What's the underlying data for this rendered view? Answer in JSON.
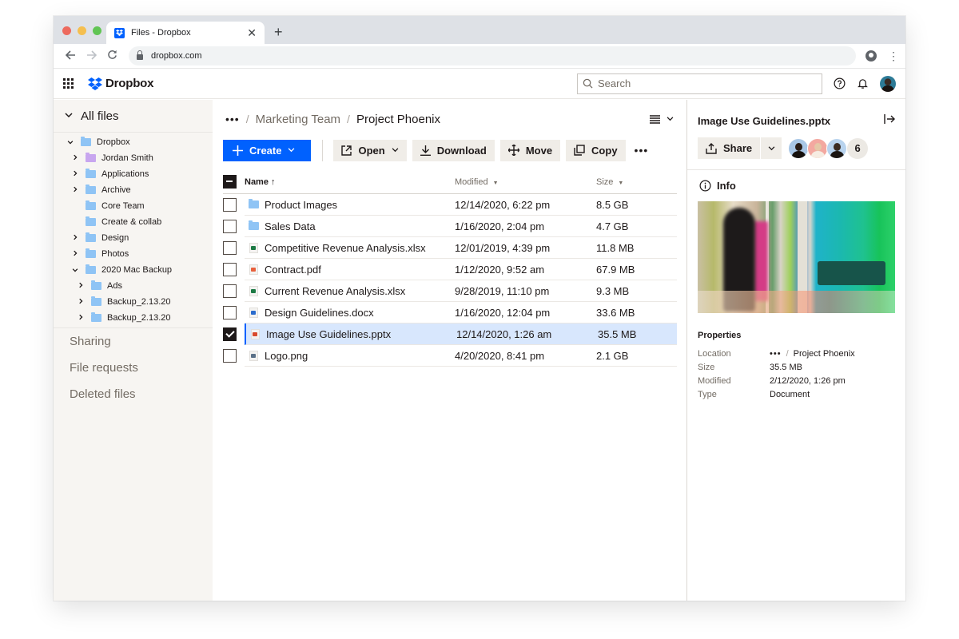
{
  "browser": {
    "tab_title": "Files - Dropbox",
    "url": "dropbox.com",
    "new_tab_label": "+"
  },
  "app": {
    "brand": "Dropbox",
    "search_placeholder": "Search",
    "accent_color": "#0061fe"
  },
  "sidebar": {
    "root_label": "All files",
    "tree": [
      {
        "label": "Dropbox",
        "level": 0,
        "expander": "expanded",
        "folder": "dropbox"
      },
      {
        "label": "Jordan Smith",
        "level": 1,
        "expander": "collapsed",
        "folder": "purple"
      },
      {
        "label": "Applications",
        "level": 1,
        "expander": "collapsed",
        "folder": "blue"
      },
      {
        "label": "Archive",
        "level": 1,
        "expander": "collapsed",
        "folder": "blue"
      },
      {
        "label": "Core Team",
        "level": 1,
        "expander": "none",
        "folder": "blue"
      },
      {
        "label": "Create & collab",
        "level": 1,
        "expander": "none",
        "folder": "shared"
      },
      {
        "label": "Design",
        "level": 1,
        "expander": "collapsed",
        "folder": "blue"
      },
      {
        "label": "Photos",
        "level": 1,
        "expander": "collapsed",
        "folder": "shared"
      },
      {
        "label": "2020 Mac Backup",
        "level": 1,
        "expander": "expanded",
        "folder": "blue"
      },
      {
        "label": "Ads",
        "level": 2,
        "expander": "collapsed",
        "folder": "shared"
      },
      {
        "label": "Backup_2.13.20",
        "level": 2,
        "expander": "collapsed",
        "folder": "blue"
      },
      {
        "label": "Backup_2.13.20",
        "level": 2,
        "expander": "collapsed",
        "folder": "blue"
      }
    ],
    "links": [
      "Sharing",
      "File requests",
      "Deleted files"
    ]
  },
  "main": {
    "breadcrumb": {
      "more": "•••",
      "parent": "Marketing Team",
      "current": "Project Phoenix"
    },
    "actions": {
      "create": "Create",
      "open": "Open",
      "download": "Download",
      "move": "Move",
      "copy": "Copy",
      "more": "•••"
    },
    "columns": {
      "name": "Name",
      "name_sort": "↑",
      "modified": "Modified",
      "size": "Size"
    },
    "files": [
      {
        "name": "Product Images",
        "type": "shared-folder",
        "modified": "12/14/2020, 6:22 pm",
        "size": "8.5 GB",
        "checked": false
      },
      {
        "name": "Sales Data",
        "type": "shared-folder",
        "modified": "1/16/2020, 2:04 pm",
        "size": "4.7 GB",
        "checked": false
      },
      {
        "name": "Competitive Revenue Analysis.xlsx",
        "type": "xlsx",
        "modified": "12/01/2019, 4:39 pm",
        "size": "11.8 MB",
        "checked": false
      },
      {
        "name": "Contract.pdf",
        "type": "pdf",
        "modified": "1/12/2020, 9:52 am",
        "size": "67.9 MB",
        "checked": false
      },
      {
        "name": "Current Revenue Analysis.xlsx",
        "type": "xlsx",
        "modified": "9/28/2019, 11:10 pm",
        "size": "9.3 MB",
        "checked": false
      },
      {
        "name": "Design Guidelines.docx",
        "type": "docx",
        "modified": "1/16/2020, 12:04 pm",
        "size": "33.6 MB",
        "checked": false
      },
      {
        "name": "Image Use Guidelines.pptx",
        "type": "pptx",
        "modified": "12/14/2020, 1:26 am",
        "size": "35.5 MB",
        "checked": true
      },
      {
        "name": "Logo.png",
        "type": "png",
        "modified": "4/20/2020, 8:41 pm",
        "size": "2.1 GB",
        "checked": false
      }
    ]
  },
  "details": {
    "title": "Image Use Guidelines.pptx",
    "share_label": "Share",
    "member_count": "6",
    "info_label": "Info",
    "properties_title": "Properties",
    "properties": [
      {
        "key": "Location",
        "value": "Project Phoenix",
        "has_more": true
      },
      {
        "key": "Size",
        "value": "35.5 MB"
      },
      {
        "key": "Modified",
        "value": "2/12/2020, 1:26 pm"
      },
      {
        "key": "Type",
        "value": "Document"
      }
    ]
  },
  "icons": {
    "tab_favicon": "dropbox-logo-icon",
    "back": "arrow-left-icon",
    "forward": "arrow-right-icon",
    "reload": "reload-icon",
    "lock": "lock-icon",
    "profile": "account-circle-icon",
    "menu": "kebab-menu-icon",
    "apps": "app-grid-icon",
    "search": "search-icon",
    "help": "help-circle-icon",
    "notifications": "bell-icon",
    "list_view": "list-view-icon",
    "collapse_panel": "collapse-right-icon",
    "share": "share-upload-icon",
    "info": "info-icon"
  },
  "file_type_colors": {
    "xlsx": "#1d7a45",
    "pdf": "#e8603c",
    "docx": "#2b6ccd",
    "pptx": "#d9492b",
    "png": "#5b7188"
  }
}
